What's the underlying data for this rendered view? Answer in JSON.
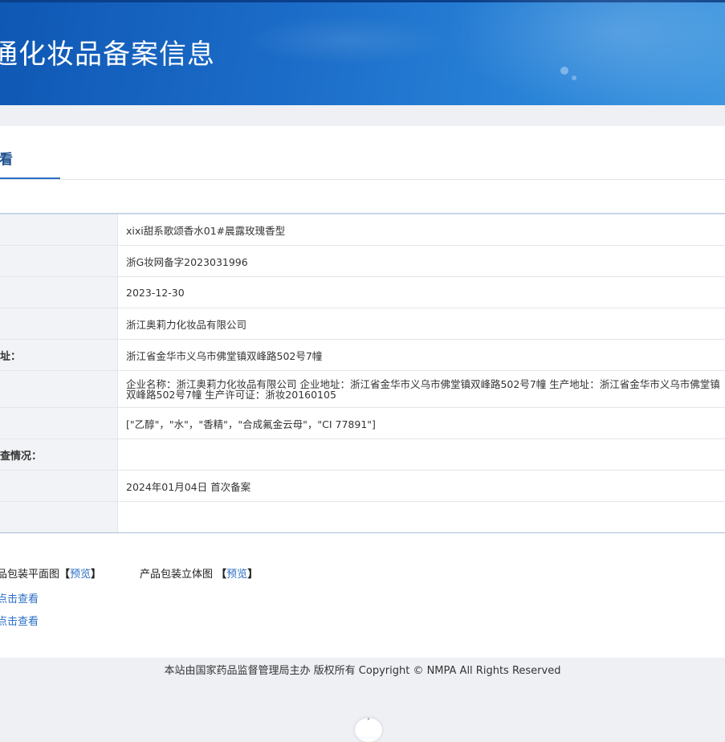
{
  "header": {
    "title": "通化妆品备案信息"
  },
  "tab": {
    "label": "查看"
  },
  "table": {
    "rows": [
      {
        "label": "",
        "value": "xixi甜系歌颂香水01#晨露玫瑰香型",
        "height": 38
      },
      {
        "label": "",
        "value": "浙G妆网备字2023031996",
        "height": 38
      },
      {
        "label": "",
        "value": "2023-12-30",
        "height": 38
      },
      {
        "label": "",
        "value": "浙江奥莉力化妆品有限公司",
        "height": 38
      },
      {
        "label": "址：",
        "value": "浙江省金华市义乌市佛堂镇双峰路502号7幢",
        "height": 38
      },
      {
        "label": "",
        "value": "企业名称：浙江奥莉力化妆品有限公司 企业地址：浙江省金华市义乌市佛堂镇双峰路502号7幢 生产地址：浙江省金华市义乌市佛堂镇双峰路502号7幢 生产许可证：浙妆20160105",
        "height": 45
      },
      {
        "label": "",
        "value": "[\"乙醇\"，\"水\"，\"香精\"，\"合成氟金云母\"，\"CI 77891\"]",
        "height": 38
      },
      {
        "label": "查情况：",
        "value": "",
        "height": 38
      },
      {
        "label": "",
        "value": "2024年01月04日 首次备案",
        "height": 38
      },
      {
        "label": "",
        "value": "",
        "height": 38
      }
    ]
  },
  "packaging": {
    "flat_label": "品包装平面图",
    "flat_open": "【",
    "flat_link": "预览",
    "flat_close": "】",
    "solid_label": "产品包装立体图",
    "solid_open": "【",
    "solid_link": "预览",
    "solid_close": "】",
    "click_links": [
      "点击查看",
      "点击查看"
    ]
  },
  "footer": {
    "text": "本站由国家药品监督管理局主办 版权所有 Copyright © NMPA All Rights Reserved"
  },
  "scroll_top": {
    "icon": "chevron-up-icon"
  }
}
